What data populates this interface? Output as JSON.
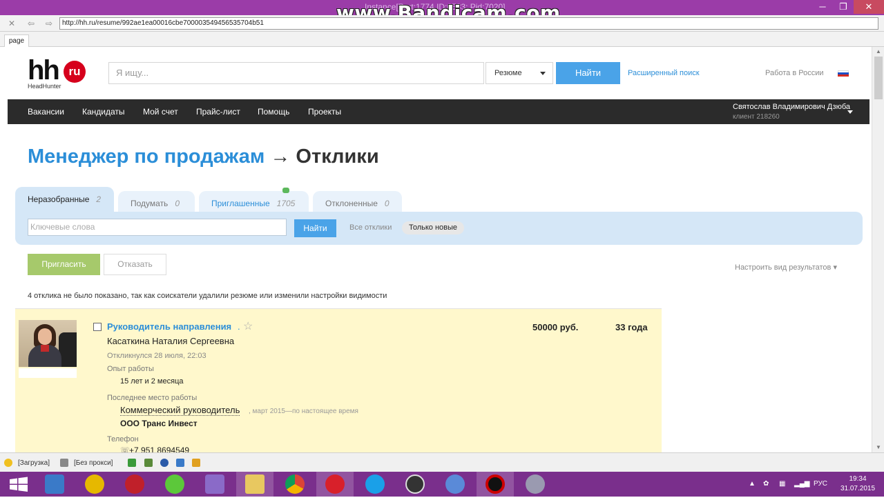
{
  "window": {
    "watermark": "www.Bandicam.com",
    "instance_text": "Instance[Port:1774 ID:6533; Pid:7020]",
    "minimize": "─",
    "restore": "❐",
    "close": "✕"
  },
  "browser": {
    "url": "http://hh.ru/resume/992ae1ea00016cbe700003549456535704b51",
    "tab_label": "page"
  },
  "header": {
    "logo_main": "hh",
    "logo_badge": "ru",
    "logo_sub": "HeadHunter",
    "search_placeholder": "Я ищу...",
    "search_scope": "Резюме",
    "search_button": "Найти",
    "advanced_search": "Расширенный поиск",
    "work_in": "Работа в России"
  },
  "nav": {
    "items": [
      "Вакансии",
      "Кандидаты",
      "Мой счет",
      "Прайс-лист",
      "Помощь",
      "Проекты"
    ],
    "user_name": "Святослав Владимирович Дзюба",
    "user_sub": "клиент 218260"
  },
  "page": {
    "title_link": "Менеджер по продажам",
    "title_rest": "→ Отклики"
  },
  "tabs": [
    {
      "label": "Неразобранные",
      "count": "2"
    },
    {
      "label": "Подумать",
      "count": "0"
    },
    {
      "label": "Приглашенные",
      "count": "1705"
    },
    {
      "label": "Отклоненные",
      "count": "0"
    }
  ],
  "filter": {
    "keywords_placeholder": "Ключевые слова",
    "find_button": "Найти",
    "all_responses": "Все отклики",
    "only_new": "Только новые"
  },
  "actions": {
    "invite": "Пригласить",
    "reject": "Отказать",
    "configure": "Настроить вид результатов ▾"
  },
  "notice": "4 отклика не было показано, так как соискатели удалили резюме или изменили настройки видимости",
  "candidate": {
    "vacancy": "Руководитель направления",
    "dot": ".",
    "star": "☆",
    "salary": "50000 руб.",
    "age": "33 года",
    "name": "Касаткина Наталия Сергеевна",
    "responded": "Откликнулся 28 июля, 22:03",
    "experience_label": "Опыт работы",
    "experience_value": "15 лет и 2 месяца",
    "last_job_label": "Последнее место работы",
    "last_job_title": "Коммерческий руководитель",
    "last_job_period": ", март 2015—по настоящее время",
    "company": "ООО Транс Инвест",
    "phone_label": "Телефон",
    "phone": "+7 951 8694549"
  },
  "statusbar": {
    "loading": "[Загрузка]",
    "proxy": "[Без прокси]"
  },
  "tray": {
    "lang": "РУС",
    "time": "19:34",
    "date": "31.07.2015"
  }
}
